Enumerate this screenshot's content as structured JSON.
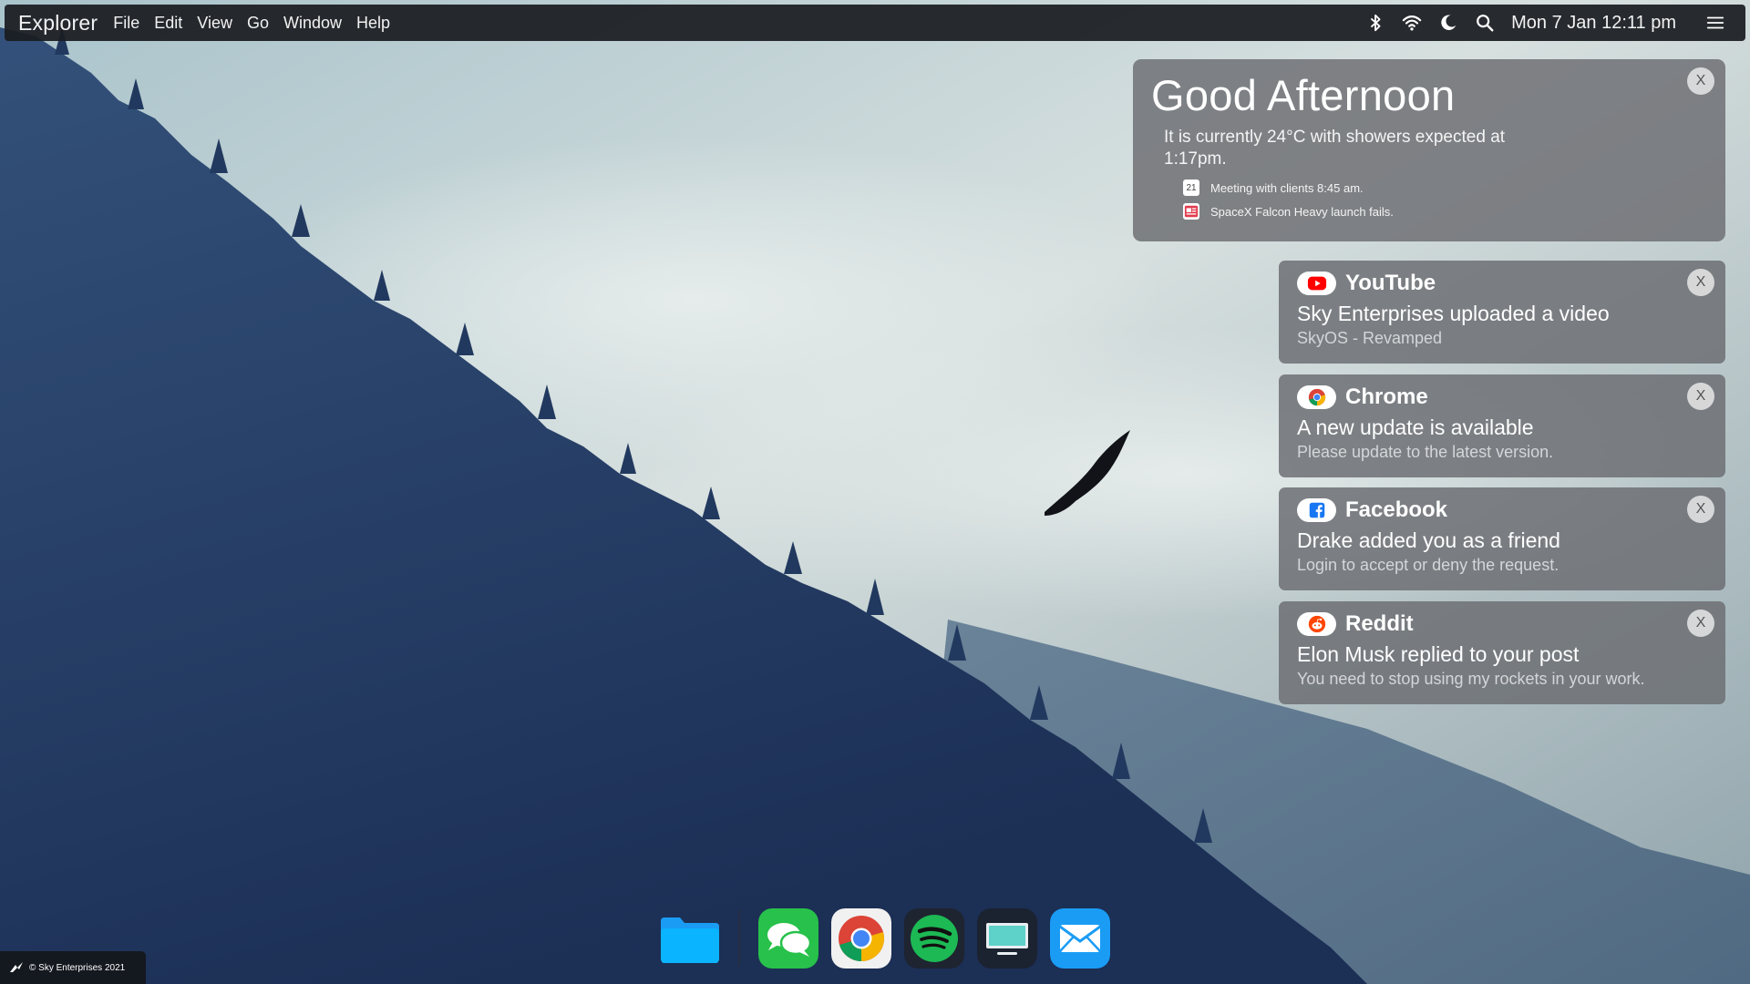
{
  "menubar": {
    "app_name": "Explorer",
    "menus": [
      "File",
      "Edit",
      "View",
      "Go",
      "Window",
      "Help"
    ],
    "clock": "Mon 7 Jan 12:11 pm",
    "status_icons": [
      "bluetooth-icon",
      "wifi-icon",
      "moon-icon",
      "search-icon",
      "hamburger-menu-icon"
    ]
  },
  "greeting": {
    "title": "Good Afternoon",
    "weather": "It is currently 24°C with showers expected at 1:17pm.",
    "events": [
      {
        "icon": "calendar-icon",
        "icon_text": "21",
        "text": "Meeting with clients 8:45 am."
      },
      {
        "icon": "news-icon",
        "text": "SpaceX Falcon Heavy launch fails."
      }
    ],
    "close_label": "X"
  },
  "notifications": [
    {
      "app": "YouTube",
      "icon": "youtube-icon",
      "title": "Sky Enterprises uploaded a video",
      "body": "SkyOS - Revamped",
      "close_label": "X"
    },
    {
      "app": "Chrome",
      "icon": "chrome-icon",
      "title": "A new update is available",
      "body": "Please update to the latest version.",
      "close_label": "X"
    },
    {
      "app": "Facebook",
      "icon": "facebook-icon",
      "title": "Drake added you as a friend",
      "body": "Login to accept or deny the request.",
      "close_label": "X"
    },
    {
      "app": "Reddit",
      "icon": "reddit-icon",
      "title": "Elon Musk replied to your post",
      "body": "You need to stop using my rockets in your work.",
      "close_label": "X"
    }
  ],
  "dock": {
    "items": [
      "folder-icon",
      "messages-icon",
      "chrome-icon",
      "spotify-icon",
      "monitor-icon",
      "mail-icon"
    ]
  },
  "copyright": "© Sky Enterprises 2021",
  "colors": {
    "menubar_bg": "#1a1c20",
    "widget_bg": "#6e7074",
    "accent_blue": "#1a9cf5",
    "messages_green": "#27c14b",
    "spotify_green": "#1db954",
    "youtube_red": "#ff0000",
    "facebook_blue": "#1877f2",
    "reddit_orange": "#ff4500"
  }
}
